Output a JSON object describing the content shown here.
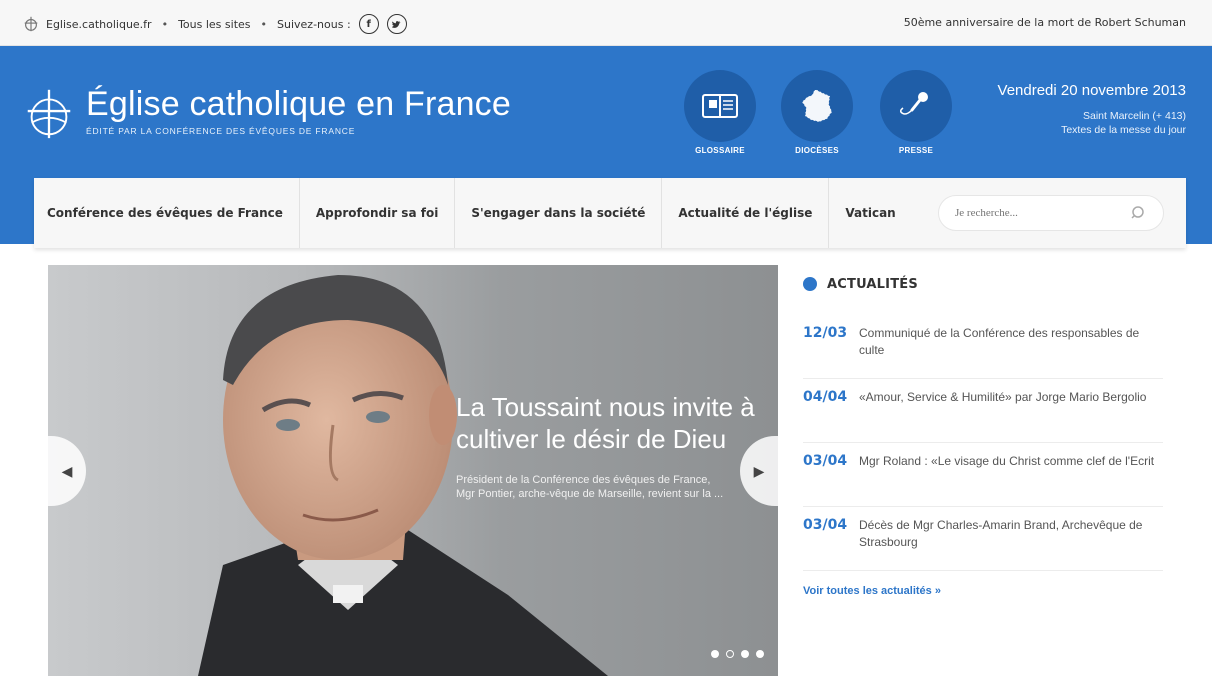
{
  "topbar": {
    "site_link": "Eglise.catholique.fr",
    "sites_link": "Tous les sites",
    "follow_label": "Suivez-nous :",
    "facebook_glyph": "f",
    "twitter_glyph": "t",
    "announcement": "50ème anniversaire de la mort de Robert Schuman",
    "separator": "•"
  },
  "header": {
    "title": "Église catholique en France",
    "subtitle": "ÉDITÉ PAR LA CONFÉRENCE DES ÉVÊQUES DE FRANCE",
    "buttons": [
      {
        "label": "GLOSSAIRE",
        "icon": "book-icon"
      },
      {
        "label": "DIOCÈSES",
        "icon": "france-map-icon"
      },
      {
        "label": "PRESSE",
        "icon": "microphone-icon"
      }
    ],
    "date": "Vendredi 20 novembre 2013",
    "saint": "Saint Marcelin (+ 413)",
    "mass_texts": "Textes de la messe du jour"
  },
  "nav": {
    "items": [
      "Conférence des évêques de France",
      "Approfondir sa foi",
      "S'engager dans la société",
      "Actualité de l'église",
      "Vatican"
    ],
    "search_placeholder": "Je recherche..."
  },
  "hero": {
    "headline": "La Toussaint nous invite à cultiver le désir de Dieu",
    "excerpt": "Président de la Conférence des évêques de France, Mgr Pontier, arche-vêque de Marseille, revient sur la ...",
    "prev_glyph": "◀",
    "next_glyph": "▶",
    "slide_count": 4,
    "active_slide": 1
  },
  "news": {
    "heading": "ACTUALITÉS",
    "items": [
      {
        "date": "12/03",
        "text": "Communiqué de la Conférence des responsables de culte"
      },
      {
        "date": "04/04",
        "text": "«Amour, Service & Humilité» par Jorge Mario Bergolio"
      },
      {
        "date": "03/04",
        "text": "Mgr Roland : «Le visage du Christ comme clef de l'Ecrit"
      },
      {
        "date": "03/04",
        "text": "Décès de Mgr Charles-Amarin Brand, Archevêque de Strasbourg"
      }
    ],
    "more_link": "Voir toutes les actualités »"
  },
  "colors": {
    "brand_blue": "#2d76c9",
    "dark_blue": "#1f5ea8",
    "topbar_bg": "#f7f7f7"
  }
}
